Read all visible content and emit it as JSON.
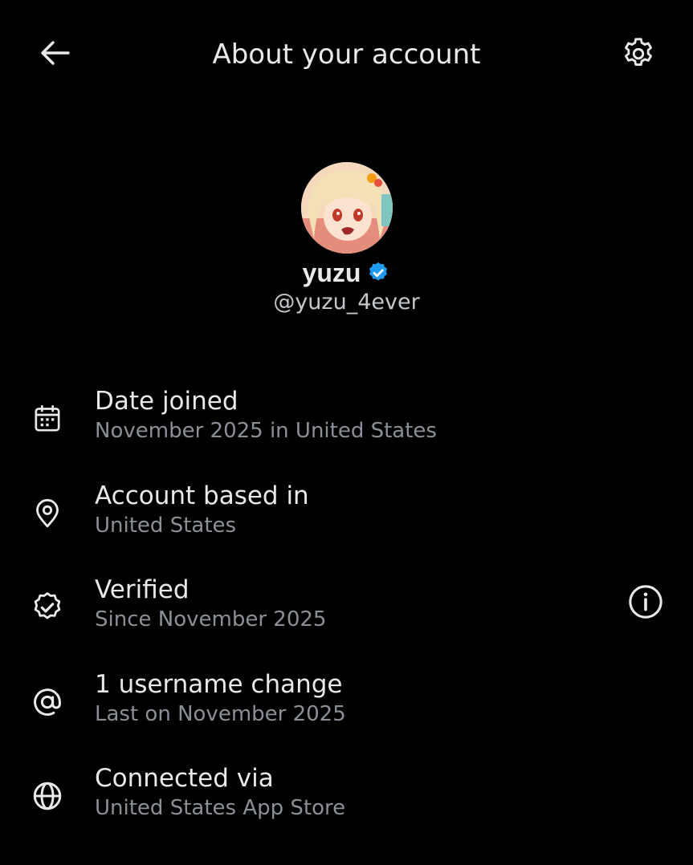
{
  "header": {
    "title": "About your account",
    "back_icon": "arrow-left-icon",
    "settings_icon": "gear-icon"
  },
  "profile": {
    "display_name": "yuzu",
    "handle": "@yuzu_4ever",
    "verified": true,
    "badge_color": "#1d9bf0"
  },
  "rows": [
    {
      "icon": "calendar-icon",
      "title": "Date joined",
      "subtitle": "November 2025 in United States"
    },
    {
      "icon": "location-pin-icon",
      "title": "Account based in",
      "subtitle": "United States"
    },
    {
      "icon": "verified-check-icon",
      "title": "Verified",
      "subtitle": "Since November 2025",
      "action_icon": "info-icon"
    },
    {
      "icon": "at-sign-icon",
      "title": "1 username change",
      "subtitle": "Last on November 2025"
    },
    {
      "icon": "globe-icon",
      "title": "Connected via",
      "subtitle": "United States App Store"
    }
  ],
  "colors": {
    "background": "#000000",
    "primary_text": "#e7e9ea",
    "secondary_text": "#8b9096",
    "accent": "#1d9bf0"
  }
}
